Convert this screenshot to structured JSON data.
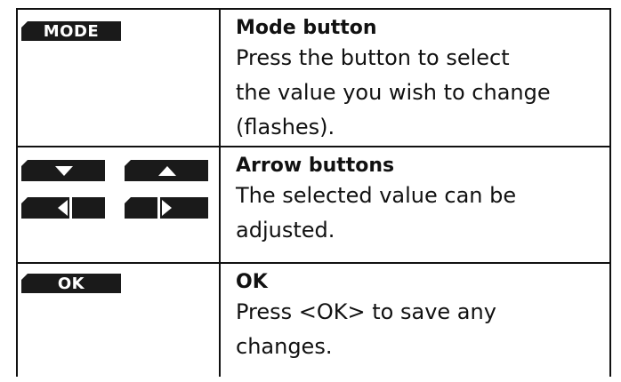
{
  "rows": [
    {
      "key_label": "MODE",
      "title": "Mode button",
      "lines": [
        "Press the button to select",
        "the value you wish to change",
        "(flashes)."
      ]
    },
    {
      "key_icons": [
        "down-arrow-icon",
        "up-arrow-icon",
        "left-arrow-icon",
        "right-arrow-icon"
      ],
      "title": "Arrow buttons",
      "lines": [
        "The selected value can be",
        "adjusted."
      ]
    },
    {
      "key_label": "OK",
      "title": "OK",
      "lines": [
        "Press <OK> to save any",
        "changes."
      ]
    }
  ]
}
